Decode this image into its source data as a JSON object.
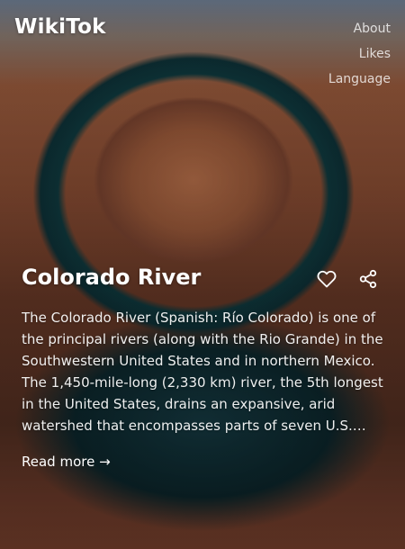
{
  "app": {
    "brand": "WikiTok"
  },
  "nav": {
    "about": "About",
    "likes": "Likes",
    "language": "Language"
  },
  "article": {
    "title": "Colorado River",
    "extract": "The Colorado River (Spanish: Río Colorado) is one of the principal rivers (along with the Rio Grande) in the Southwestern United States and in northern Mexico. The 1,450-mile-long (2,330 km) river, the 5th longest in the United States, drains an expansive, arid watershed that encompasses parts of seven U.S. states and two Mexican states.",
    "read_more": "Read more →"
  },
  "icons": {
    "like": "heart-icon",
    "share": "share-icon"
  }
}
